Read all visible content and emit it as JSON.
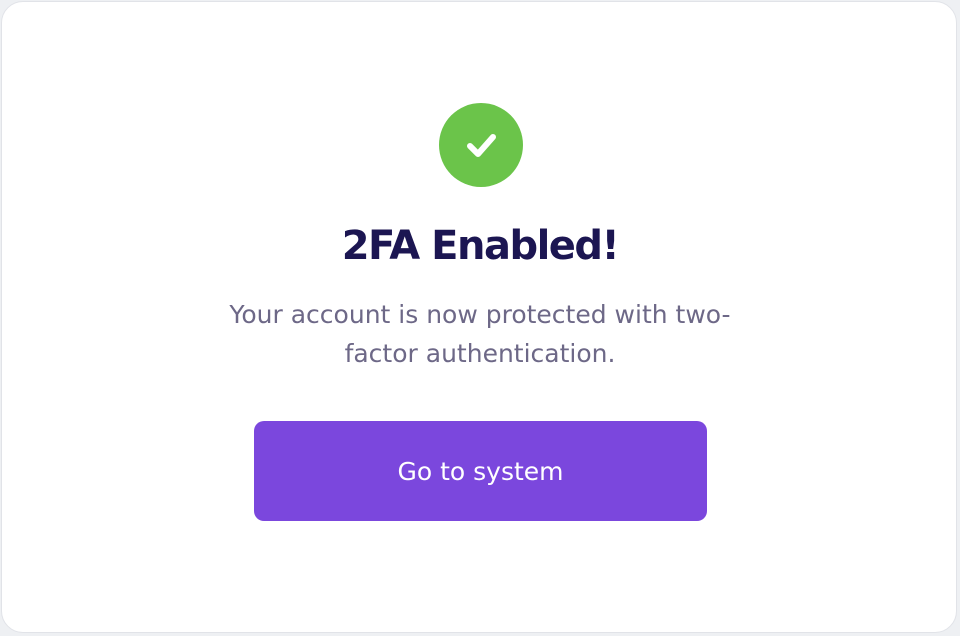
{
  "success_dialog": {
    "icon": "check-circle-icon",
    "icon_color": "#6bc44a",
    "title": "2FA Enabled!",
    "message": "Your account is now protected with two-factor authentication.",
    "primary_action_label": "Go to system",
    "primary_action_color": "#7b47dd",
    "title_color": "#1c1652",
    "message_color": "#6d6887"
  }
}
